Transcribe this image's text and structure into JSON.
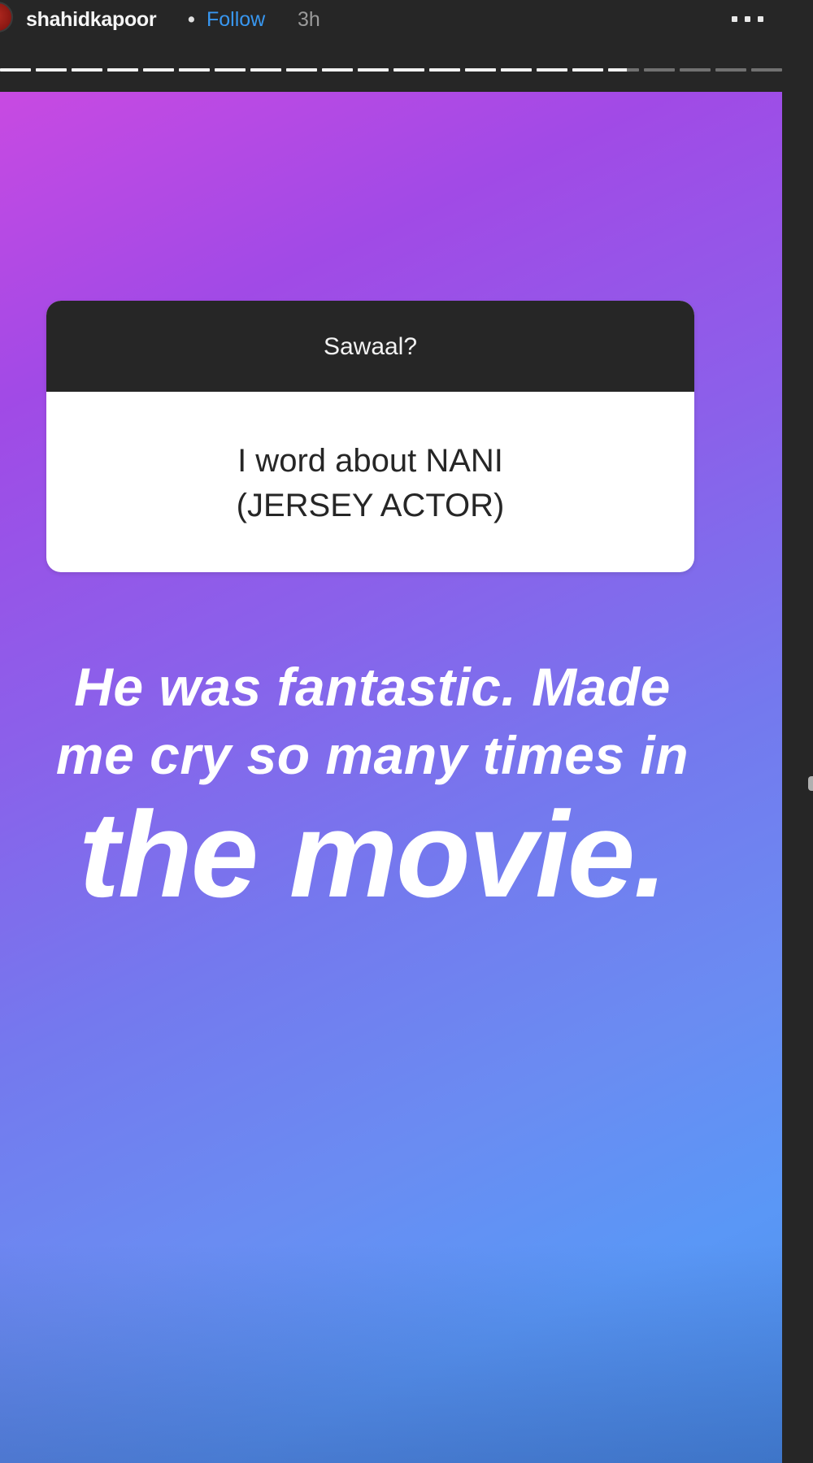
{
  "header": {
    "username": "shahidkapoor",
    "separator": "•",
    "follow_label": "Follow",
    "time": "3h",
    "more_icon": "more-horizontal-icon"
  },
  "progress": {
    "segments_total": 22,
    "segments_viewed": 17,
    "current_segment_fill": 0.6
  },
  "story": {
    "question_sticker": {
      "title": "Sawaal?",
      "answer_line_1": "I word about NANI",
      "answer_line_2": "(JERSEY ACTOR)"
    },
    "reply": {
      "line_1": "He was fantastic. Made",
      "line_2": "me cry so many times in",
      "line_3": "the movie."
    }
  },
  "colors": {
    "background": "#262626",
    "follow": "#3897f0",
    "gradient_start": "#c84ae2",
    "gradient_end": "#5a97f6"
  }
}
